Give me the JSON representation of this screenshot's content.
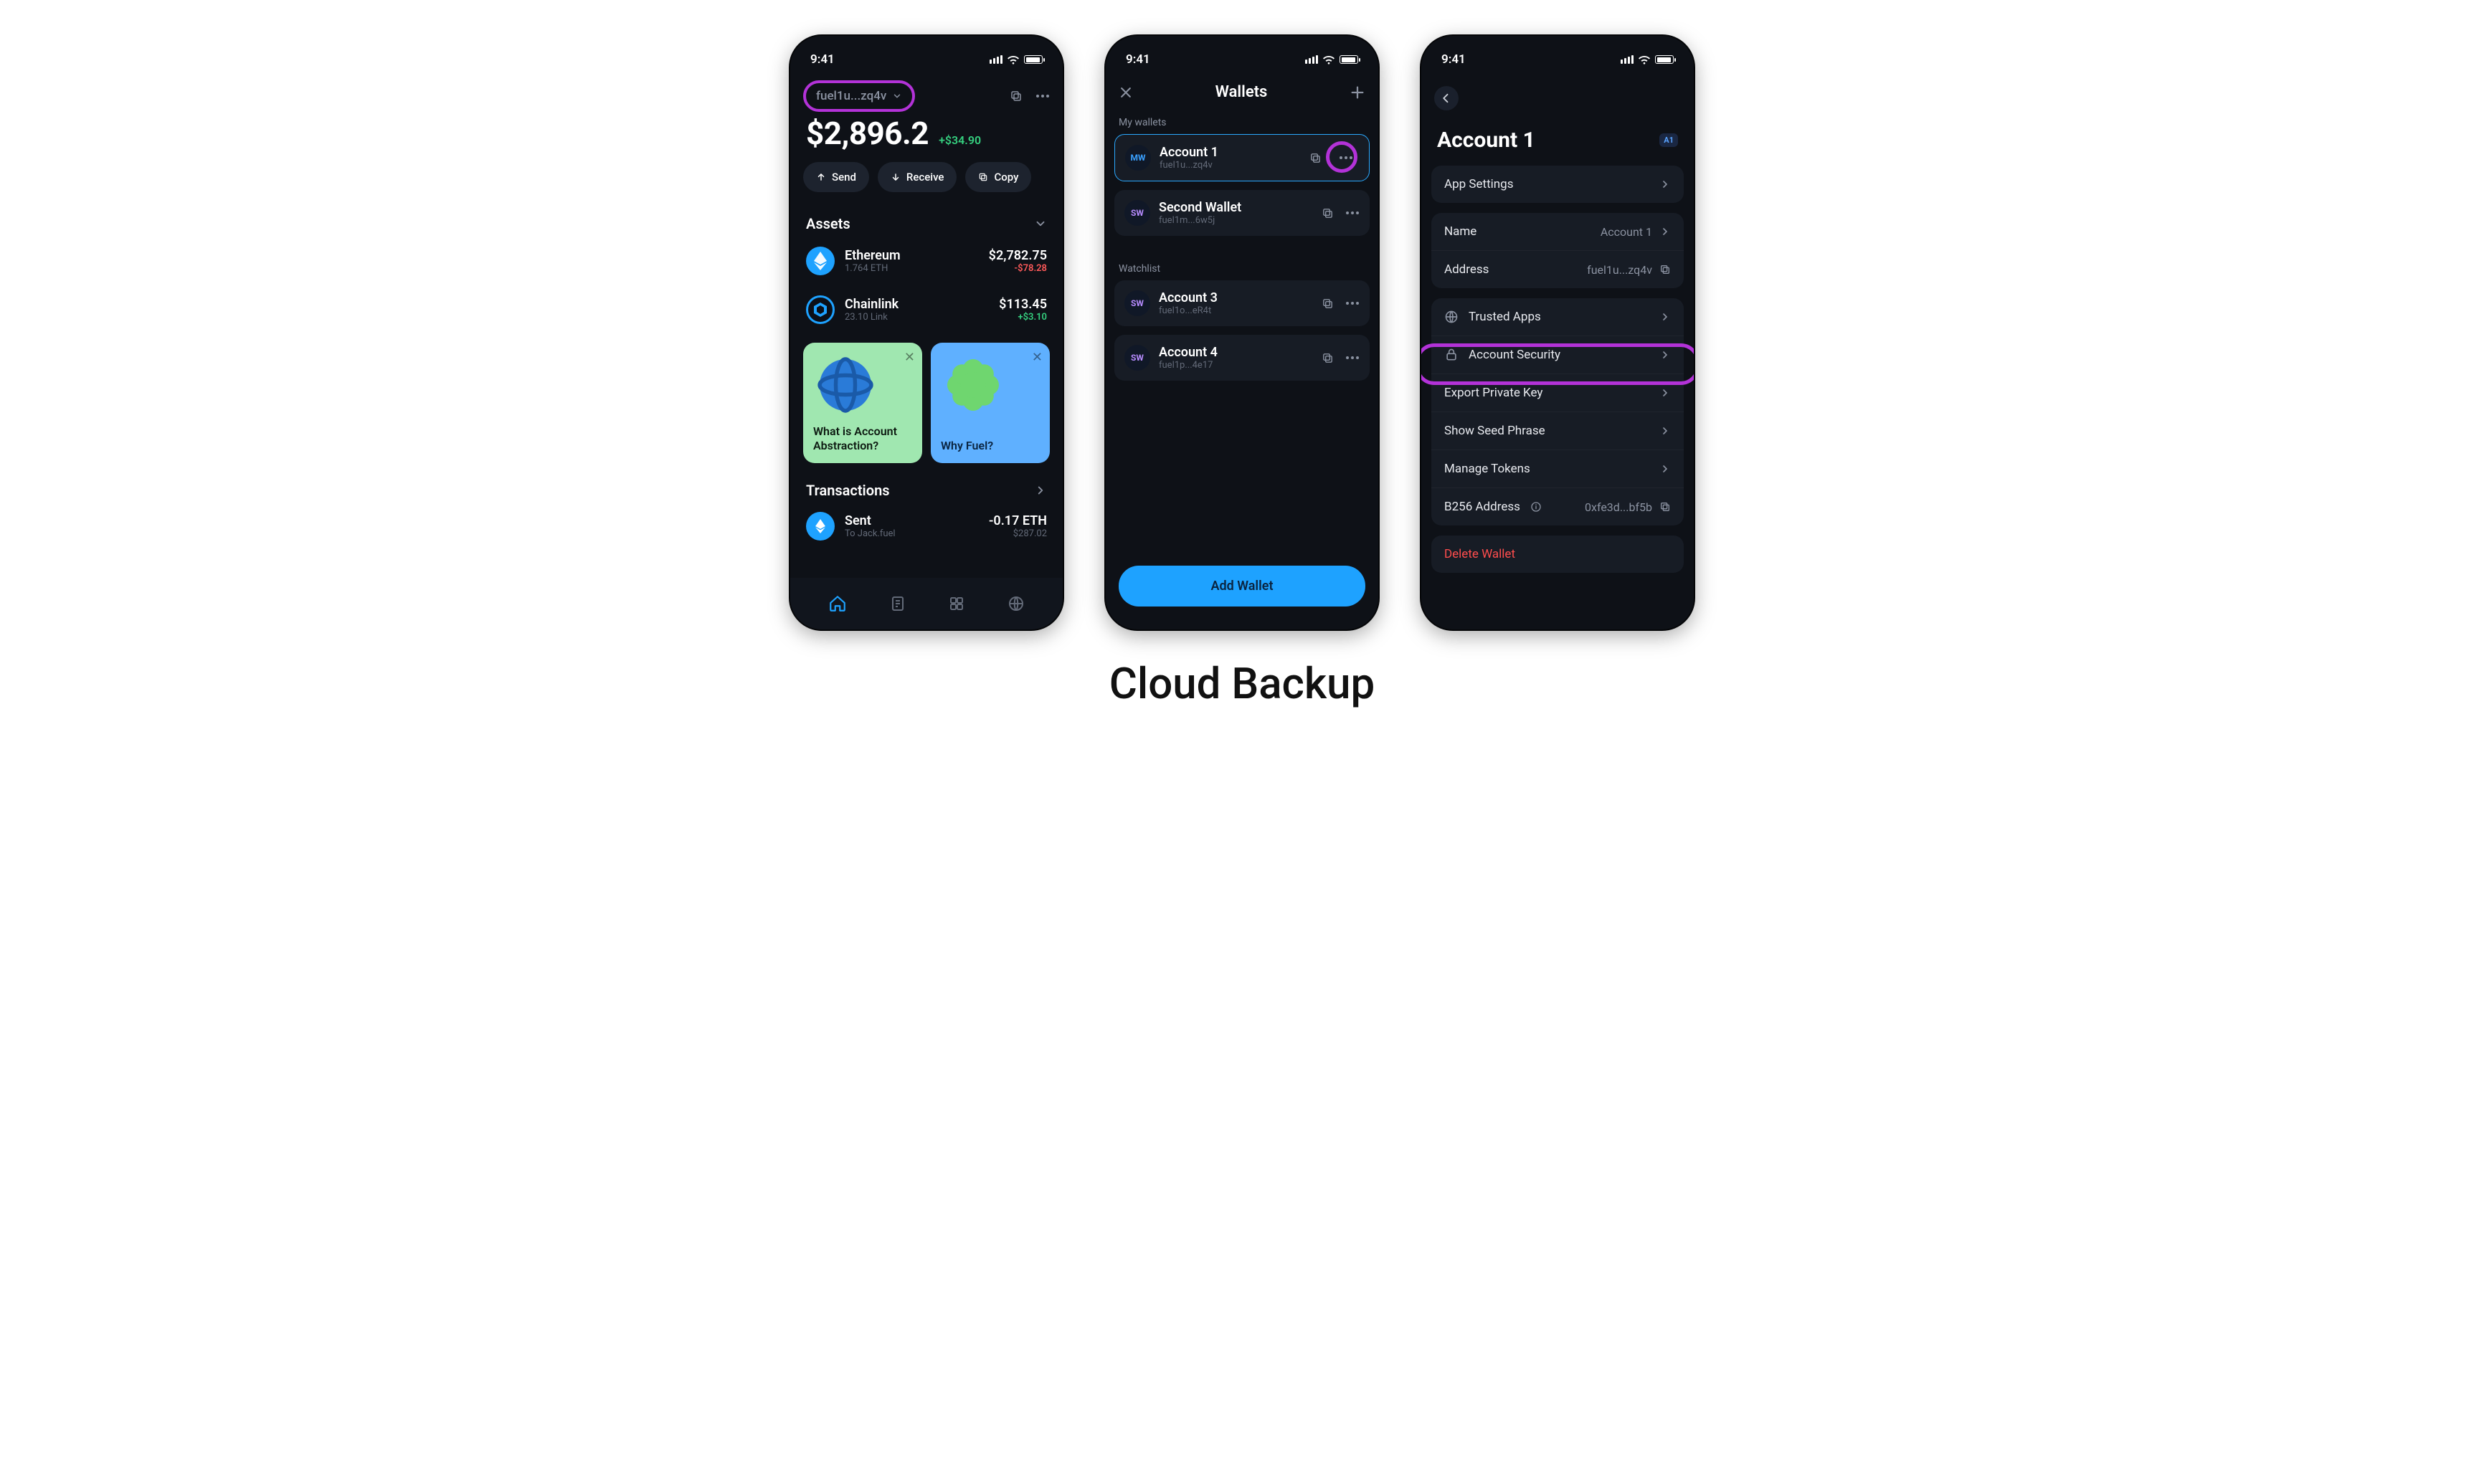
{
  "caption": "Cloud Backup",
  "status": {
    "time": "9:41"
  },
  "screen1": {
    "address_short": "fuel1u...zq4v",
    "balance": "$2,896.2",
    "balance_delta": "+$34.90",
    "actions": {
      "send": "Send",
      "receive": "Receive",
      "copy": "Copy"
    },
    "assets_header": "Assets",
    "assets": [
      {
        "name": "Ethereum",
        "sub": "1.764 ETH",
        "value": "$2,782.75",
        "delta": "-$78.28",
        "delta_sign": "neg",
        "icon": "eth",
        "color": "#1ea2ff"
      },
      {
        "name": "Chainlink",
        "sub": "23.10 Link",
        "value": "$113.45",
        "delta": "+$3.10",
        "delta_sign": "pos",
        "icon": "link",
        "color": "#1ea2ff"
      }
    ],
    "promos": [
      {
        "label": "What is Account Abstraction?",
        "variant": "green"
      },
      {
        "label": "Why Fuel?",
        "variant": "blue"
      }
    ],
    "transactions_header": "Transactions",
    "transactions": [
      {
        "title": "Sent",
        "sub": "To Jack.fuel",
        "value": "-0.17 ETH",
        "fiat": "$287.02"
      }
    ]
  },
  "screen2": {
    "title": "Wallets",
    "subhead_mine": "My wallets",
    "subhead_watch": "Watchlist",
    "wallets_mine": [
      {
        "badge": "MW",
        "badge_color": "blue",
        "title": "Account 1",
        "sub": "fuel1u...zq4v",
        "selected": true
      },
      {
        "badge": "SW",
        "badge_color": "purple",
        "title": "Second Wallet",
        "sub": "fuel1m...6w5j",
        "selected": false
      }
    ],
    "wallets_watch": [
      {
        "badge": "SW",
        "badge_color": "purple",
        "title": "Account 3",
        "sub": "fuel1o...eR4t"
      },
      {
        "badge": "SW",
        "badge_color": "purple",
        "title": "Account 4",
        "sub": "fuel1p...4e17"
      }
    ],
    "add_wallet": "Add Wallet"
  },
  "screen3": {
    "title": "Account 1",
    "badge": "A1",
    "group1": [
      {
        "label": "App Settings"
      }
    ],
    "group2": [
      {
        "label": "Name",
        "value": "Account 1"
      },
      {
        "label": "Address",
        "value": "fuel1u...zq4v",
        "trailing": "copy"
      }
    ],
    "group3": [
      {
        "label": "Trusted Apps",
        "leading": "globe"
      },
      {
        "label": "Account Security",
        "leading": "lock",
        "highlighted": true
      },
      {
        "label": "Export Private Key"
      },
      {
        "label": "Show Seed Phrase"
      },
      {
        "label": "Manage Tokens"
      },
      {
        "label": "B256 Address",
        "value": "0xfe3d...bf5b",
        "info": true,
        "trailing": "copy"
      }
    ],
    "group4": [
      {
        "label": "Delete Wallet",
        "danger": true
      }
    ]
  }
}
